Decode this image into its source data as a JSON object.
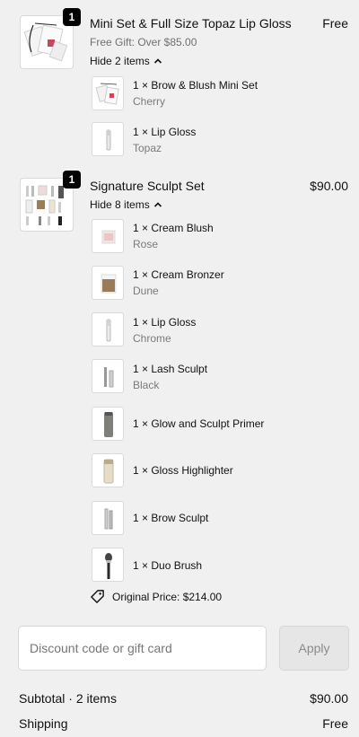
{
  "products": [
    {
      "title": "Mini Set & Full Size Topaz Lip Gloss",
      "subtitle": "Free Gift: Over $85.00",
      "price": "Free",
      "quantity": "1",
      "toggle_label": "Hide 2 items",
      "items": [
        {
          "name": "1 × Brow & Blush Mini Set",
          "variant": "Cherry"
        },
        {
          "name": "1 × Lip Gloss",
          "variant": "Topaz"
        }
      ]
    },
    {
      "title": "Signature Sculpt Set",
      "price": "$90.00",
      "quantity": "1",
      "toggle_label": "Hide 8 items",
      "items": [
        {
          "name": "1 × Cream Blush",
          "variant": "Rose"
        },
        {
          "name": "1 × Cream Bronzer",
          "variant": "Dune"
        },
        {
          "name": "1 × Lip Gloss",
          "variant": "Chrome"
        },
        {
          "name": "1 × Lash Sculpt",
          "variant": "Black"
        },
        {
          "name": "1 × Glow and Sculpt Primer"
        },
        {
          "name": "1 × Gloss Highlighter"
        },
        {
          "name": "1 × Brow Sculpt"
        },
        {
          "name": "1 × Duo Brush"
        }
      ],
      "original_price": "Original Price: $214.00"
    }
  ],
  "discount": {
    "placeholder": "Discount code or gift card",
    "apply_label": "Apply"
  },
  "summary": {
    "subtotal_label": "Subtotal · 2 items",
    "subtotal_value": "$90.00",
    "shipping_label": "Shipping",
    "shipping_value": "Free"
  },
  "colors": {
    "background": "#f0f0f0",
    "badge": "#000000",
    "muted_text": "#707070"
  },
  "icons": {
    "chevron": "chevron-up-icon",
    "tag": "price-tag-icon"
  }
}
